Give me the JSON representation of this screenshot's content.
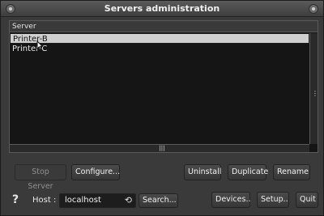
{
  "window": {
    "title": "Servers administration"
  },
  "list": {
    "header": "Server",
    "items": [
      "Printer-B",
      "Printer-C"
    ],
    "selected_index": 0
  },
  "buttons": {
    "stop_server": "Stop Server",
    "configure": "Configure...",
    "uninstall": "Uninstall",
    "duplicate": "Duplicate",
    "rename": "Rename",
    "search": "Search...",
    "devices": "Devices..",
    "setup": "Setup..",
    "quit": "Quit"
  },
  "footer": {
    "help": "?",
    "host_label": "Host :",
    "host_value": "localhost"
  },
  "icons": {
    "close": "close-icon",
    "menu": "window-menu-icon",
    "refresh": "refresh-icon",
    "cursor": "mouse-cursor-icon"
  }
}
